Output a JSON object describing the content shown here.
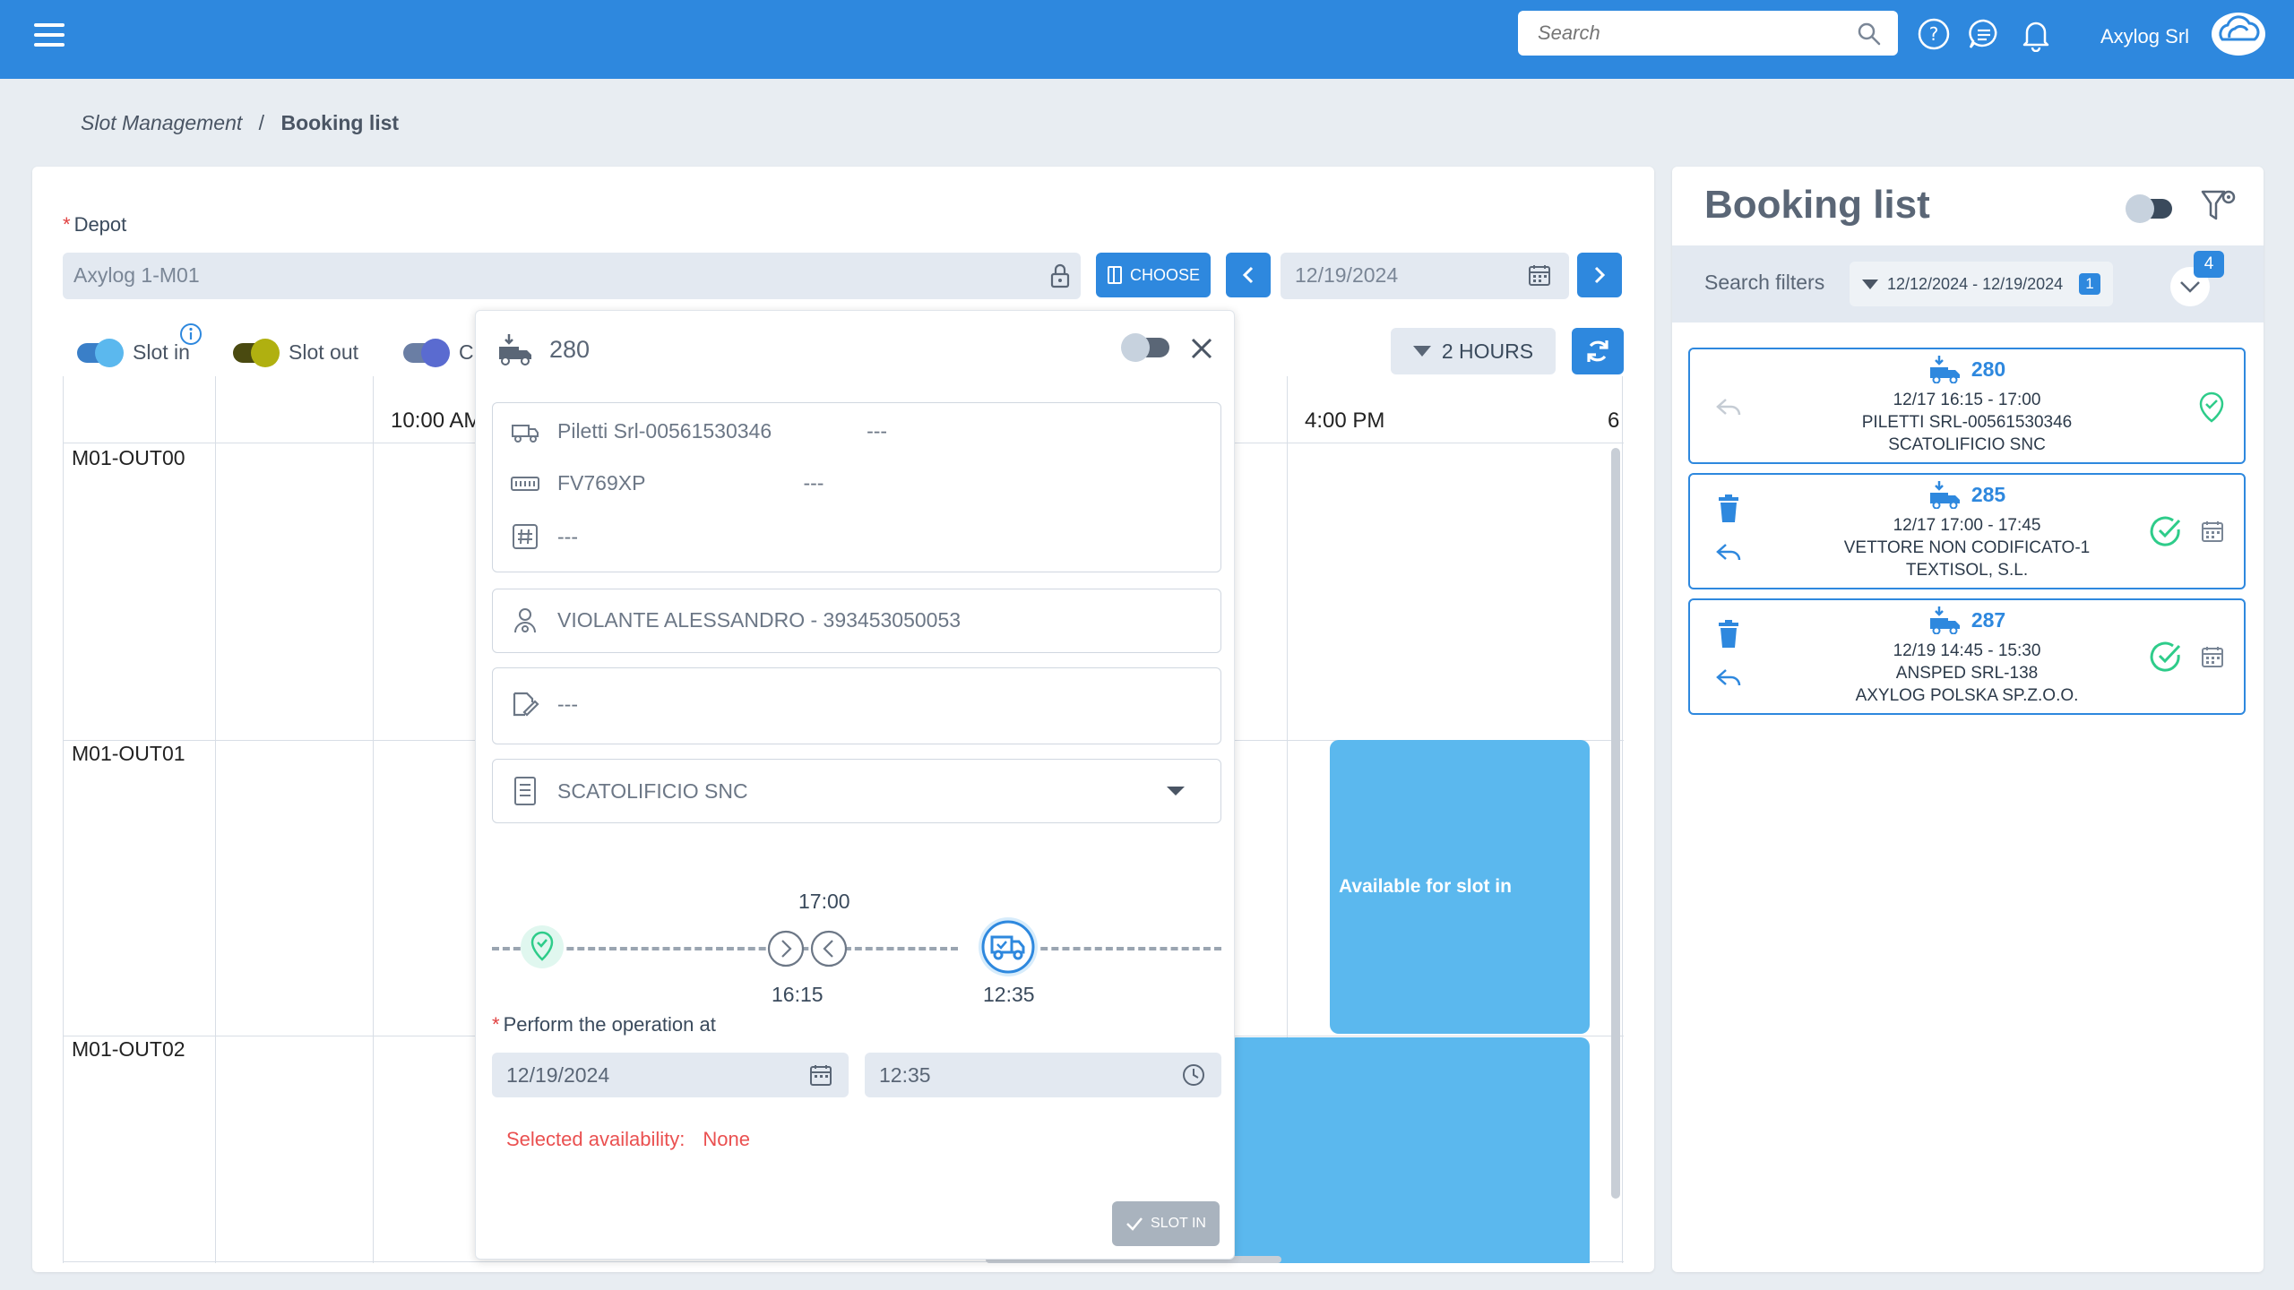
{
  "header": {
    "search_placeholder": "Search",
    "user_name": "Axylog Srl",
    "icons": [
      "menu-icon",
      "search-icon",
      "help-icon",
      "chat-icon",
      "bell-icon",
      "company-logo"
    ]
  },
  "breadcrumb": {
    "parent": "Slot Management",
    "separator": "/",
    "current": "Booking list"
  },
  "depot": {
    "label": "Depot",
    "required_mark": "*",
    "value": "Axylog 1-M01",
    "choose_label": "CHOOSE",
    "date": "12/19/2024"
  },
  "legend": {
    "slot_in": "Slot in",
    "slot_out": "Slot out",
    "third": "Cl"
  },
  "hours_button": "2 HOURS",
  "schedule": {
    "times": [
      "10:00 AM",
      "4:00 PM",
      "6"
    ],
    "rows": [
      "M01-OUT00",
      "M01-OUT01",
      "M01-OUT02"
    ],
    "available_label": "Available for slot in"
  },
  "popup": {
    "booking_number": "280",
    "carrier": "Piletti Srl-00561530346",
    "carrier_extra": "---",
    "plate": "FV769XP",
    "plate_extra": "---",
    "reference": "---",
    "driver": "VIOLANTE ALESSANDRO - 393453050053",
    "notes": "---",
    "customer": "SCATOLIFICIO SNC",
    "timeline": {
      "top_time": "17:00",
      "mid_time": "16:15",
      "end_time": "12:35"
    },
    "perform_label": "Perform the operation at",
    "perform_date": "12/19/2024",
    "perform_time": "12:35",
    "availability_label": "Selected availability:",
    "availability_value": "None",
    "slot_in_button": "SLOT IN"
  },
  "booking_list": {
    "title": "Booking list",
    "search_filters_label": "Search filters",
    "date_range": "12/12/2024 - 12/19/2024",
    "date_badge": "1",
    "count_badge": "4",
    "cards": [
      {
        "number": "280",
        "time": "12/17 16:15 - 17:00",
        "carrier": "PILETTI SRL-00561530346",
        "customer": "SCATOLIFICIO SNC"
      },
      {
        "number": "285",
        "time": "12/17 17:00 - 17:45",
        "carrier": "VETTORE NON CODIFICATO-1",
        "customer": "TEXTISOL, S.L."
      },
      {
        "number": "287",
        "time": "12/19 14:45 - 15:30",
        "carrier": "ANSPED SRL-138",
        "customer": "AXYLOG POLSKA SP.Z.O.O."
      }
    ]
  },
  "colors": {
    "primary": "#2e88de",
    "slot_block": "#5bb8ee",
    "slot_in_toggle": "#5bb8ee",
    "slot_out_toggle": "#b0b010",
    "third_toggle": "#5a6bd0",
    "success": "#2ecc8a",
    "error_text": "#ea5050"
  }
}
